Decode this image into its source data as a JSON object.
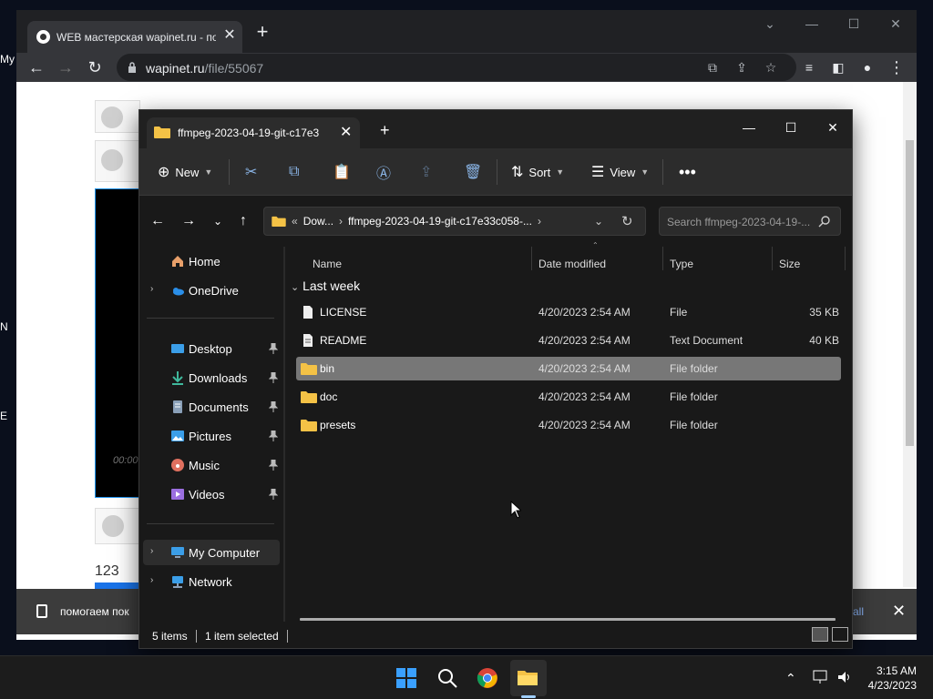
{
  "desktop": {
    "labels": [
      "My",
      "N",
      "E"
    ]
  },
  "chrome": {
    "tab_title": "WEB мастерская wapinet.ru - по",
    "url_host": "wapinet.ru",
    "url_path": "/file/55067",
    "page": {
      "video_time": "00:00",
      "number": "123",
      "notification_text": "помогаем пок",
      "notification_action": "all"
    }
  },
  "explorer": {
    "tab_title": "ffmpeg-2023-04-19-git-c17e3",
    "commands": {
      "new": "New",
      "sort": "Sort",
      "view": "View"
    },
    "address": {
      "overflow": "«",
      "segment1": "Dow...",
      "segment2": "ffmpeg-2023-04-19-git-c17e33c058-..."
    },
    "search_placeholder": "Search ffmpeg-2023-04-19-...",
    "sidebar": {
      "home": "Home",
      "onedrive": "OneDrive",
      "desktop": "Desktop",
      "downloads": "Downloads",
      "documents": "Documents",
      "pictures": "Pictures",
      "music": "Music",
      "videos": "Videos",
      "my_computer": "My Computer",
      "network": "Network"
    },
    "columns": {
      "name": "Name",
      "date": "Date modified",
      "type": "Type",
      "size": "Size"
    },
    "group": "Last week",
    "files": [
      {
        "name": "LICENSE",
        "date": "4/20/2023 2:54 AM",
        "type": "File",
        "size": "35 KB",
        "icon": "file-icon"
      },
      {
        "name": "README",
        "date": "4/20/2023 2:54 AM",
        "type": "Text Document",
        "size": "40 KB",
        "icon": "text-file-icon"
      },
      {
        "name": "bin",
        "date": "4/20/2023 2:54 AM",
        "type": "File folder",
        "size": "",
        "icon": "folder-icon",
        "selected": true
      },
      {
        "name": "doc",
        "date": "4/20/2023 2:54 AM",
        "type": "File folder",
        "size": "",
        "icon": "folder-icon"
      },
      {
        "name": "presets",
        "date": "4/20/2023 2:54 AM",
        "type": "File folder",
        "size": "",
        "icon": "folder-icon"
      }
    ],
    "status": {
      "items": "5 items",
      "selected": "1 item selected"
    }
  },
  "taskbar": {
    "time": "3:15 AM",
    "date": "4/23/2023"
  },
  "colors": {
    "folder": "#f4c246",
    "accent": "#0078d4",
    "selected_row": "#777777"
  }
}
